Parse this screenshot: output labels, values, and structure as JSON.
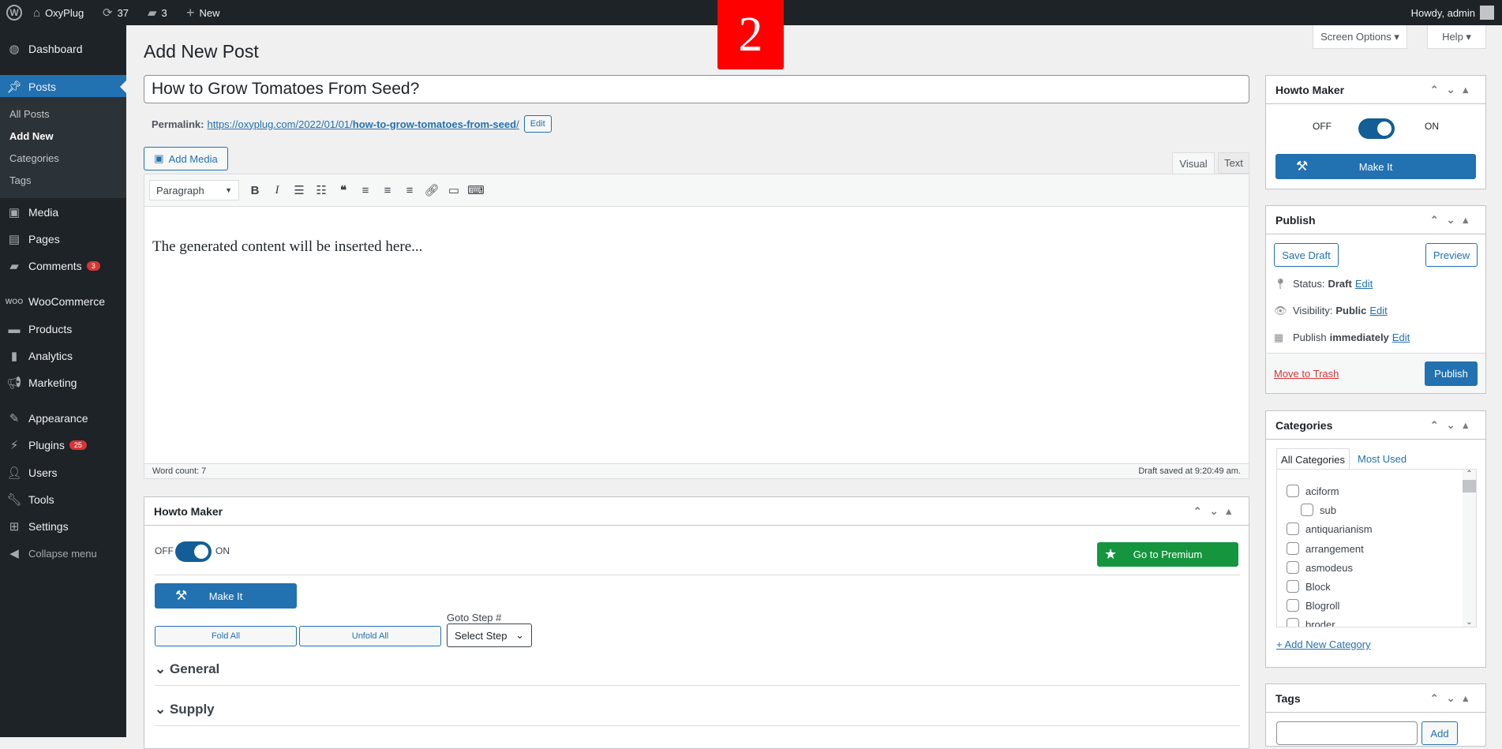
{
  "adminbar": {
    "site": "OxyPlug",
    "updates": "37",
    "comments": "3",
    "new": "New",
    "howdy": "Howdy, admin"
  },
  "sidebar": {
    "items": [
      {
        "label": "Dashboard",
        "icon": "dashboard-icon"
      },
      {
        "label": "Posts",
        "icon": "pin-icon"
      },
      {
        "label": "Media",
        "icon": "media-icon"
      },
      {
        "label": "Pages",
        "icon": "pages-icon"
      },
      {
        "label": "Comments",
        "icon": "comment-icon",
        "badge": "3"
      },
      {
        "label": "WooCommerce",
        "icon": "woo-icon"
      },
      {
        "label": "Products",
        "icon": "archive-icon"
      },
      {
        "label": "Analytics",
        "icon": "chart-icon"
      },
      {
        "label": "Marketing",
        "icon": "megaphone-icon"
      },
      {
        "label": "Appearance",
        "icon": "brush-icon"
      },
      {
        "label": "Plugins",
        "icon": "plug-icon",
        "badge": "25"
      },
      {
        "label": "Users",
        "icon": "user-icon"
      },
      {
        "label": "Tools",
        "icon": "wrench-icon"
      },
      {
        "label": "Settings",
        "icon": "sliders-icon"
      },
      {
        "label": "Collapse menu",
        "icon": "collapse-icon"
      }
    ],
    "submenu": [
      "All Posts",
      "Add New",
      "Categories",
      "Tags"
    ]
  },
  "step_badge": "2",
  "header": {
    "title": "Add New Post",
    "screen_options": "Screen Options ▾",
    "help": "Help ▾"
  },
  "post": {
    "title": "How to Grow Tomatoes From Seed?",
    "permalink_label": "Permalink:",
    "permalink_base": "https://oxyplug.com/2022/01/01/",
    "permalink_slug": "how-to-grow-tomatoes-from-seed",
    "permalink_end": "/",
    "edit": "Edit"
  },
  "editor": {
    "add_media": "Add Media",
    "tab_visual": "Visual",
    "tab_text": "Text",
    "format": "Paragraph",
    "content": "The generated content will be inserted here...",
    "word_count": "Word count: 7",
    "draft_saved": "Draft saved at 9:20:49 am."
  },
  "howto_main": {
    "title": "Howto Maker",
    "off": "OFF",
    "on": "ON",
    "toggle_on": true,
    "premium": "Go to Premium",
    "make_it": "Make It",
    "fold_all": "Fold All",
    "unfold_all": "Unfold All",
    "goto_label": "Goto Step #",
    "select_step": "Select Step",
    "sections": [
      "General",
      "Supply"
    ]
  },
  "howto_side": {
    "title": "Howto Maker",
    "off": "OFF",
    "on": "ON",
    "toggle_on": true,
    "make_it": "Make It"
  },
  "publish": {
    "title": "Publish",
    "save_draft": "Save Draft",
    "preview": "Preview",
    "status_label": "Status:",
    "status": "Draft",
    "visibility_label": "Visibility:",
    "visibility": "Public",
    "publish_label": "Publish",
    "publish_when": "immediately",
    "edit": "Edit",
    "trash": "Move to Trash",
    "publish_btn": "Publish"
  },
  "categories": {
    "title": "Categories",
    "tab_all": "All Categories",
    "tab_most": "Most Used",
    "items": [
      "aciform",
      "sub",
      "antiquarianism",
      "arrangement",
      "asmodeus",
      "Block",
      "Blogroll",
      "broder"
    ],
    "add_new": "+ Add New Category"
  },
  "tags": {
    "title": "Tags",
    "add": "Add"
  }
}
